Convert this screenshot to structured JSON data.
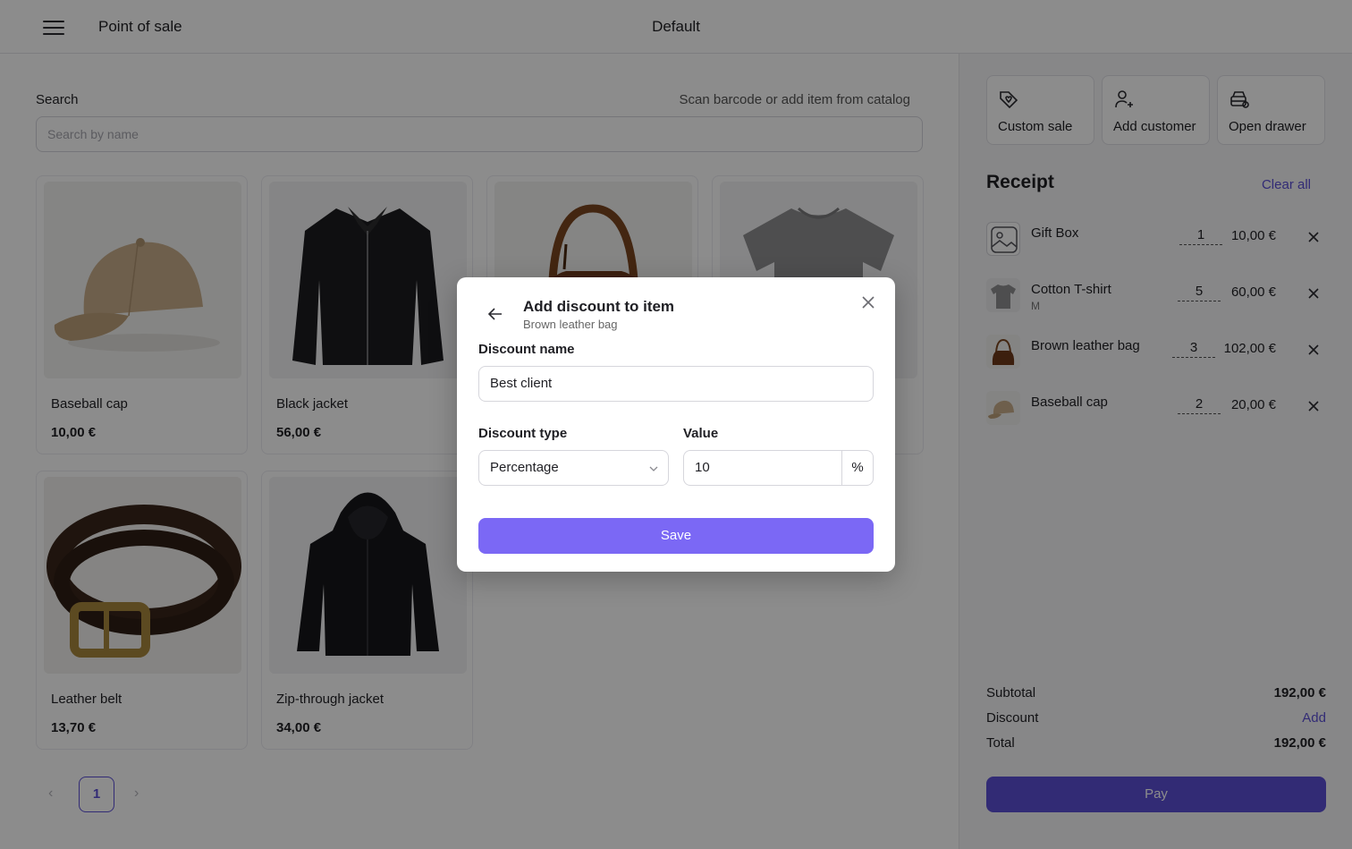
{
  "header": {
    "app_title": "Point of sale",
    "register_name": "Default"
  },
  "search": {
    "label": "Search",
    "hint": "Scan barcode or add item from catalog",
    "placeholder": "Search by name"
  },
  "products": [
    {
      "name": "Baseball cap",
      "price": "10,00 €",
      "icon": "cap-image"
    },
    {
      "name": "Black jacket",
      "price": "56,00 €",
      "icon": "jacket-image"
    },
    {
      "name": "Brown leather bag",
      "price": "",
      "icon": "bag-image"
    },
    {
      "name": "Cotton T-shirt",
      "price": "",
      "icon": "tshirt-image"
    },
    {
      "name": "Leather belt",
      "price": "13,70 €",
      "icon": "belt-image"
    },
    {
      "name": "Zip-through jacket",
      "price": "34,00 €",
      "icon": "hoodie-image"
    }
  ],
  "pagination": {
    "current_page": "1",
    "prev": "‹",
    "next": "›"
  },
  "quick_actions": [
    {
      "label": "Custom sale",
      "icon": "tag-heart-icon"
    },
    {
      "label": "Add customer",
      "icon": "user-add-icon"
    },
    {
      "label": "Open drawer",
      "icon": "drawer-icon"
    }
  ],
  "receipt": {
    "title": "Receipt",
    "clear_all": "Clear all",
    "items": [
      {
        "name": "Gift Box",
        "variant": "",
        "qty": "1",
        "price": "10,00 €"
      },
      {
        "name": "Cotton T-shirt",
        "variant": "M",
        "qty": "5",
        "price": "60,00 €"
      },
      {
        "name": "Brown leather bag",
        "variant": "",
        "qty": "3",
        "price": "102,00 €"
      },
      {
        "name": "Baseball cap",
        "variant": "",
        "qty": "2",
        "price": "20,00 €"
      }
    ],
    "subtotal_label": "Subtotal",
    "subtotal_value": "192,00 €",
    "discount_label": "Discount",
    "discount_action": "Add",
    "total_label": "Total",
    "total_value": "192,00 €",
    "pay_label": "Pay"
  },
  "modal": {
    "title": "Add discount to item",
    "subtitle": "Brown leather bag",
    "name_label": "Discount name",
    "name_value": "Best client",
    "type_label": "Discount type",
    "type_value": "Percentage",
    "value_label": "Value",
    "value": "10",
    "unit": "%",
    "save_label": "Save"
  },
  "colors": {
    "accent": "#5b4fd6",
    "save_button": "#7b68f5"
  }
}
